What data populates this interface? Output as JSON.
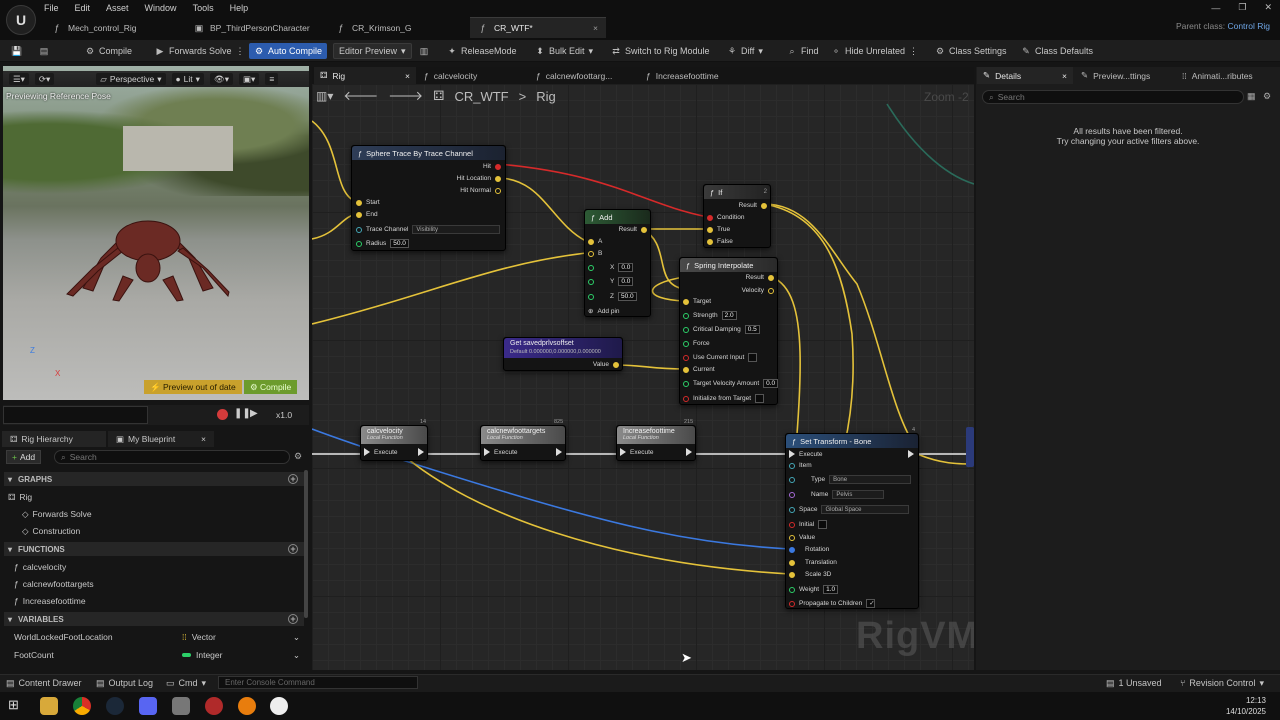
{
  "app": {
    "logo": "U",
    "menus": [
      "File",
      "Edit",
      "Asset",
      "Window",
      "Tools",
      "Help"
    ],
    "tabs": [
      {
        "label": "Mech_control_Rig",
        "close": ""
      },
      {
        "label": "BP_ThirdPersonCharacter",
        "close": ""
      },
      {
        "label": "CR_Krimson_G",
        "close": ""
      },
      {
        "label": "CR_WTF*",
        "close": "×"
      }
    ],
    "window_controls": [
      "—",
      "❐",
      "✕"
    ],
    "parent_class_label": "Parent class:",
    "parent_class_value": "Control Rig"
  },
  "toolbar": {
    "compile": "Compile",
    "forwards_solve": "Forwards Solve",
    "auto_compile": "Auto Compile",
    "editor_preview": "Editor Preview",
    "release_mode": "ReleaseMode",
    "bulk_edit": "Bulk Edit",
    "switch_rig": "Switch to Rig Module",
    "diff": "Diff",
    "find": "Find",
    "hide_unrelated": "Hide Unrelated",
    "class_settings": "Class Settings",
    "class_defaults": "Class Defaults",
    "accent": "#2c5cae"
  },
  "viewport": {
    "perspective": "Perspective",
    "lit": "Lit",
    "preview_note": "Previewing Reference Pose",
    "preview_out_of_date": "Preview out of date",
    "compile_badge": "Compile",
    "axis_z": "Z",
    "axis_x": "X",
    "speed": "x1.0"
  },
  "left_panel": {
    "tab_hierarchy": "Rig Hierarchy",
    "tab_blueprint": "My Blueprint",
    "tab_close": "×",
    "add": "Add",
    "search_placeholder": "Search",
    "graphs_header": "GRAPHS",
    "graphs": [
      "Rig",
      "Forwards Solve",
      "Construction"
    ],
    "functions_header": "FUNCTIONS",
    "functions": [
      "calcvelocity",
      "calcnewfoottargets",
      "Increasefoottime"
    ],
    "variables_header": "VARIABLES",
    "variables": [
      {
        "name": "WorldLockedFootLocation",
        "type": "Vector",
        "color": "#e4c23a"
      },
      {
        "name": "FootCount",
        "type": "Integer",
        "color": "#2ccf68"
      }
    ]
  },
  "graph": {
    "tabs": [
      "Rig",
      "calcvelocity",
      "calcnewfoottarg...",
      "Increasefoottime"
    ],
    "tab_close": "×",
    "breadcrumb_asset": "CR_WTF",
    "breadcrumb_sep": ">",
    "breadcrumb_graph": "Rig",
    "zoom": "Zoom -2",
    "watermark": "RigVM",
    "nodes": {
      "sphere_trace": {
        "title": "Sphere Trace By Trace Channel",
        "hit": "Hit",
        "hit_location": "Hit Location",
        "hit_normal": "Hit Normal",
        "start": "Start",
        "end": "End",
        "trace_channel": "Trace Channel",
        "trace_value": "Visibility",
        "radius": "Radius",
        "radius_value": "50.0"
      },
      "add": {
        "title": "Add",
        "result": "Result",
        "a": "A",
        "b": "B",
        "x": "X",
        "x_val": "0.0",
        "y": "Y",
        "y_val": "0.0",
        "z": "Z",
        "z_val": "50.0",
        "add_pin": "Add pin"
      },
      "if": {
        "title": "If",
        "result": "Result",
        "condition": "Condition",
        "true": "True",
        "false": "False",
        "count": "2"
      },
      "spring": {
        "title": "Spring Interpolate",
        "result": "Result",
        "velocity": "Velocity",
        "target": "Target",
        "strength": "Strength",
        "strength_val": "2.0",
        "damping": "Critical Damping",
        "damping_val": "0.5",
        "force": "Force",
        "use_current": "Use Current Input",
        "current": "Current",
        "target_velocity": "Target Velocity Amount",
        "target_velocity_val": "0.0",
        "init_target": "Initialize from Target"
      },
      "get_saved": {
        "title": "Get savedprlvsoffset",
        "subtitle": "Default 0.000000,0.000000,0.000000",
        "value": "Value"
      },
      "calcvelocity": {
        "title": "calcvelocity",
        "subtitle": "Local Function",
        "execute": "Execute",
        "count": "14"
      },
      "calcnewfoottargets": {
        "title": "calcnewfoottargets",
        "subtitle": "Local Function",
        "execute": "Execute",
        "count": "825"
      },
      "increasefoottime": {
        "title": "Increasefoottime",
        "subtitle": "Local Function",
        "execute": "Execute",
        "count": "215"
      },
      "set_transform": {
        "title": "Set Transform - Bone",
        "count": "4",
        "execute": "Execute",
        "item": "Item",
        "type": "Type",
        "type_val": "Bone",
        "name": "Name",
        "name_val": "Pelvis",
        "space": "Space",
        "space_val": "Global Space",
        "initial": "Initial",
        "value": "Value",
        "rotation": "Rotation",
        "translation": "Translation",
        "scale": "Scale 3D",
        "weight": "Weight",
        "weight_val": "1.0",
        "propagate": "Propagate to Children",
        "propagate_check": "✓"
      }
    }
  },
  "details": {
    "tab_details": "Details",
    "tab_preview": "Preview...ttings",
    "tab_anim": "Animati...ributes",
    "tab_close": "×",
    "search_placeholder": "Search",
    "filtered_line1": "All results have been filtered.",
    "filtered_line2": "Try changing your active filters above."
  },
  "bottom": {
    "content_drawer": "Content Drawer",
    "output_log": "Output Log",
    "cmd": "Cmd",
    "console_placeholder": "Enter Console Command",
    "unsaved": "1 Unsaved",
    "revision_control": "Revision Control"
  },
  "taskbar": {
    "time": "12:13",
    "date": "14/10/2025"
  }
}
